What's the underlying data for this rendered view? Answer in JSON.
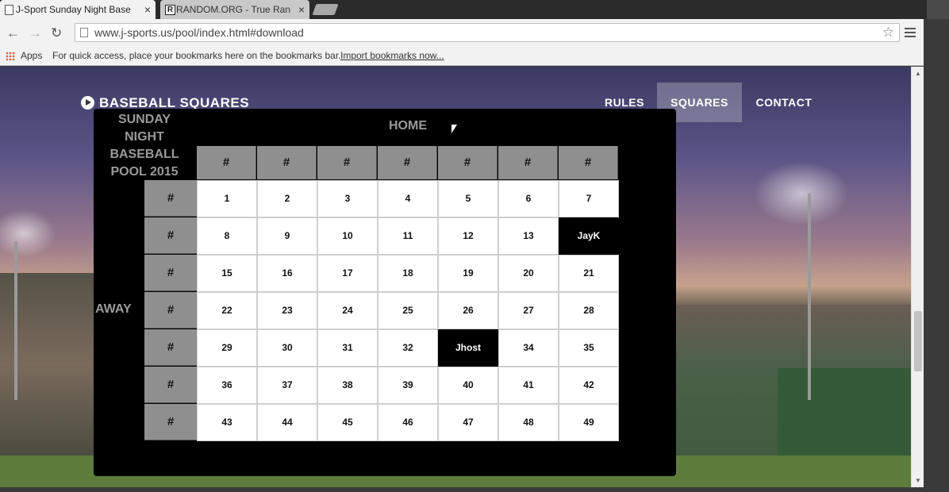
{
  "browser": {
    "tabs": [
      {
        "title": "J-Sport Sunday Night Base",
        "active": true
      },
      {
        "title": "RANDOM.ORG - True Ran",
        "active": false,
        "favicon_letter": "R"
      }
    ],
    "close_glyph": "×",
    "url": "www.j-sports.us/pool/index.html#download",
    "bookmarks": {
      "apps_label": "Apps",
      "hint": "For quick access, place your bookmarks here on the bookmarks bar.",
      "import_link": "Import bookmarks now..."
    }
  },
  "site": {
    "brand": "BASEBALL SQUARES",
    "nav": [
      {
        "label": "RULES",
        "active": false
      },
      {
        "label": "SQUARES",
        "active": true
      },
      {
        "label": "CONTACT",
        "active": false
      }
    ]
  },
  "pool": {
    "title_lines": [
      "SUNDAY",
      "NIGHT",
      "BASEBALL",
      "POOL 2015"
    ],
    "home_label": "HOME",
    "away_label": "AWAY",
    "column_headers": [
      "#",
      "#",
      "#",
      "#",
      "#",
      "#",
      "#"
    ],
    "row_headers": [
      "#",
      "#",
      "#",
      "#",
      "#",
      "#",
      "#"
    ],
    "rows": [
      [
        "1",
        "2",
        "3",
        "4",
        "5",
        "6",
        "7"
      ],
      [
        "8",
        "9",
        "10",
        "11",
        "12",
        "13",
        "JayK"
      ],
      [
        "15",
        "16",
        "17",
        "18",
        "19",
        "20",
        "21"
      ],
      [
        "22",
        "23",
        "24",
        "25",
        "26",
        "27",
        "28"
      ],
      [
        "29",
        "30",
        "31",
        "32",
        "Jhost",
        "34",
        "35"
      ],
      [
        "36",
        "37",
        "38",
        "39",
        "40",
        "41",
        "42"
      ],
      [
        "43",
        "44",
        "45",
        "46",
        "47",
        "48",
        "49"
      ]
    ],
    "taken_squares": [
      "JayK",
      "Jhost"
    ]
  },
  "icons": {
    "back": "arrow-left-icon",
    "forward": "arrow-right-icon",
    "reload": "reload-icon",
    "bookmark_star": "star-icon",
    "menu": "hamburger-menu-icon",
    "brand": "play-circle-icon"
  }
}
